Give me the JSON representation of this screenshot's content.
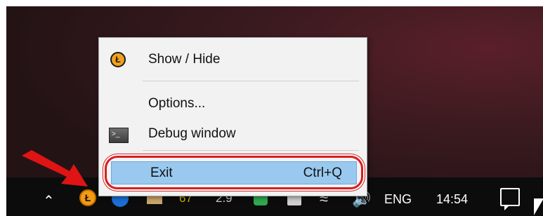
{
  "menu": {
    "show_hide": "Show / Hide",
    "options": "Options...",
    "debug": "Debug window",
    "exit": "Exit",
    "exit_shortcut": "Ctrl+Q"
  },
  "taskbar": {
    "gpu_temp": "67",
    "cpu_value": "2.9",
    "language": "ENG",
    "time": "14:54"
  },
  "colors": {
    "highlight": "#99c9ef",
    "annotation_red": "#d81e1e",
    "litecoin_orange": "#f0a020"
  },
  "icons": [
    "litecoin-icon",
    "debug-console-icon",
    "chevron-up-icon",
    "wifi-icon",
    "speaker-icon",
    "action-center-icon"
  ]
}
